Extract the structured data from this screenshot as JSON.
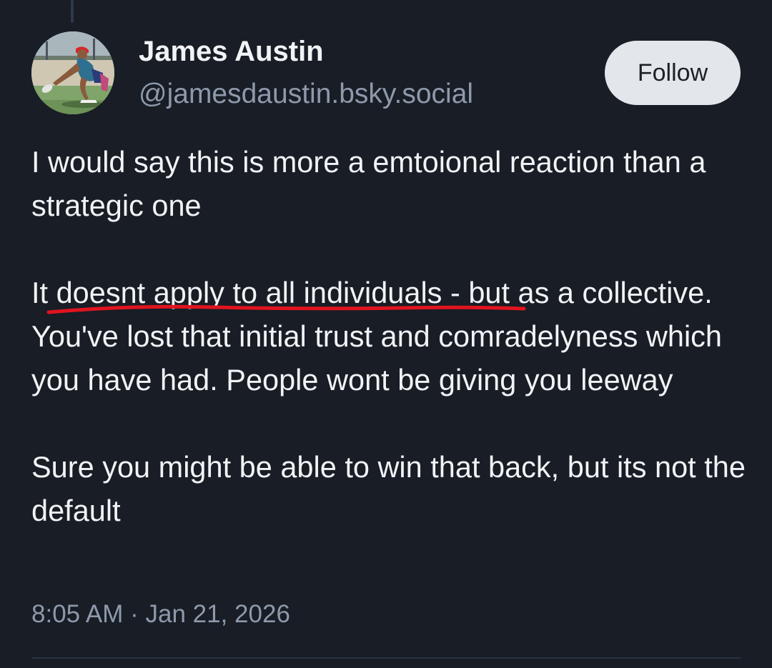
{
  "post": {
    "author": {
      "display_name": "James Austin",
      "handle": "@jamesdaustin.bsky.social"
    },
    "follow_label": "Follow",
    "body": {
      "paragraph_1": "I would say this is more a emtoional reaction than a strategic one",
      "paragraph_2_underlined": "It doesnt apply to all individuals",
      "paragraph_2_rest": " - but as a collective. You've lost that initial trust and comradelyness which you have had. People wont be giving you leeway",
      "paragraph_3": "Sure you might be able to win that back, but its not the default"
    },
    "timestamp": "8:05 AM · Jan 21, 2026"
  },
  "annotation": {
    "type": "hand-drawn underline",
    "color": "#e0141e"
  },
  "colors": {
    "background": "#181d26",
    "text_primary": "#f1f3f5",
    "text_secondary": "#8e9aab",
    "button_bg": "#e3e6ea",
    "button_text": "#1c2128"
  }
}
